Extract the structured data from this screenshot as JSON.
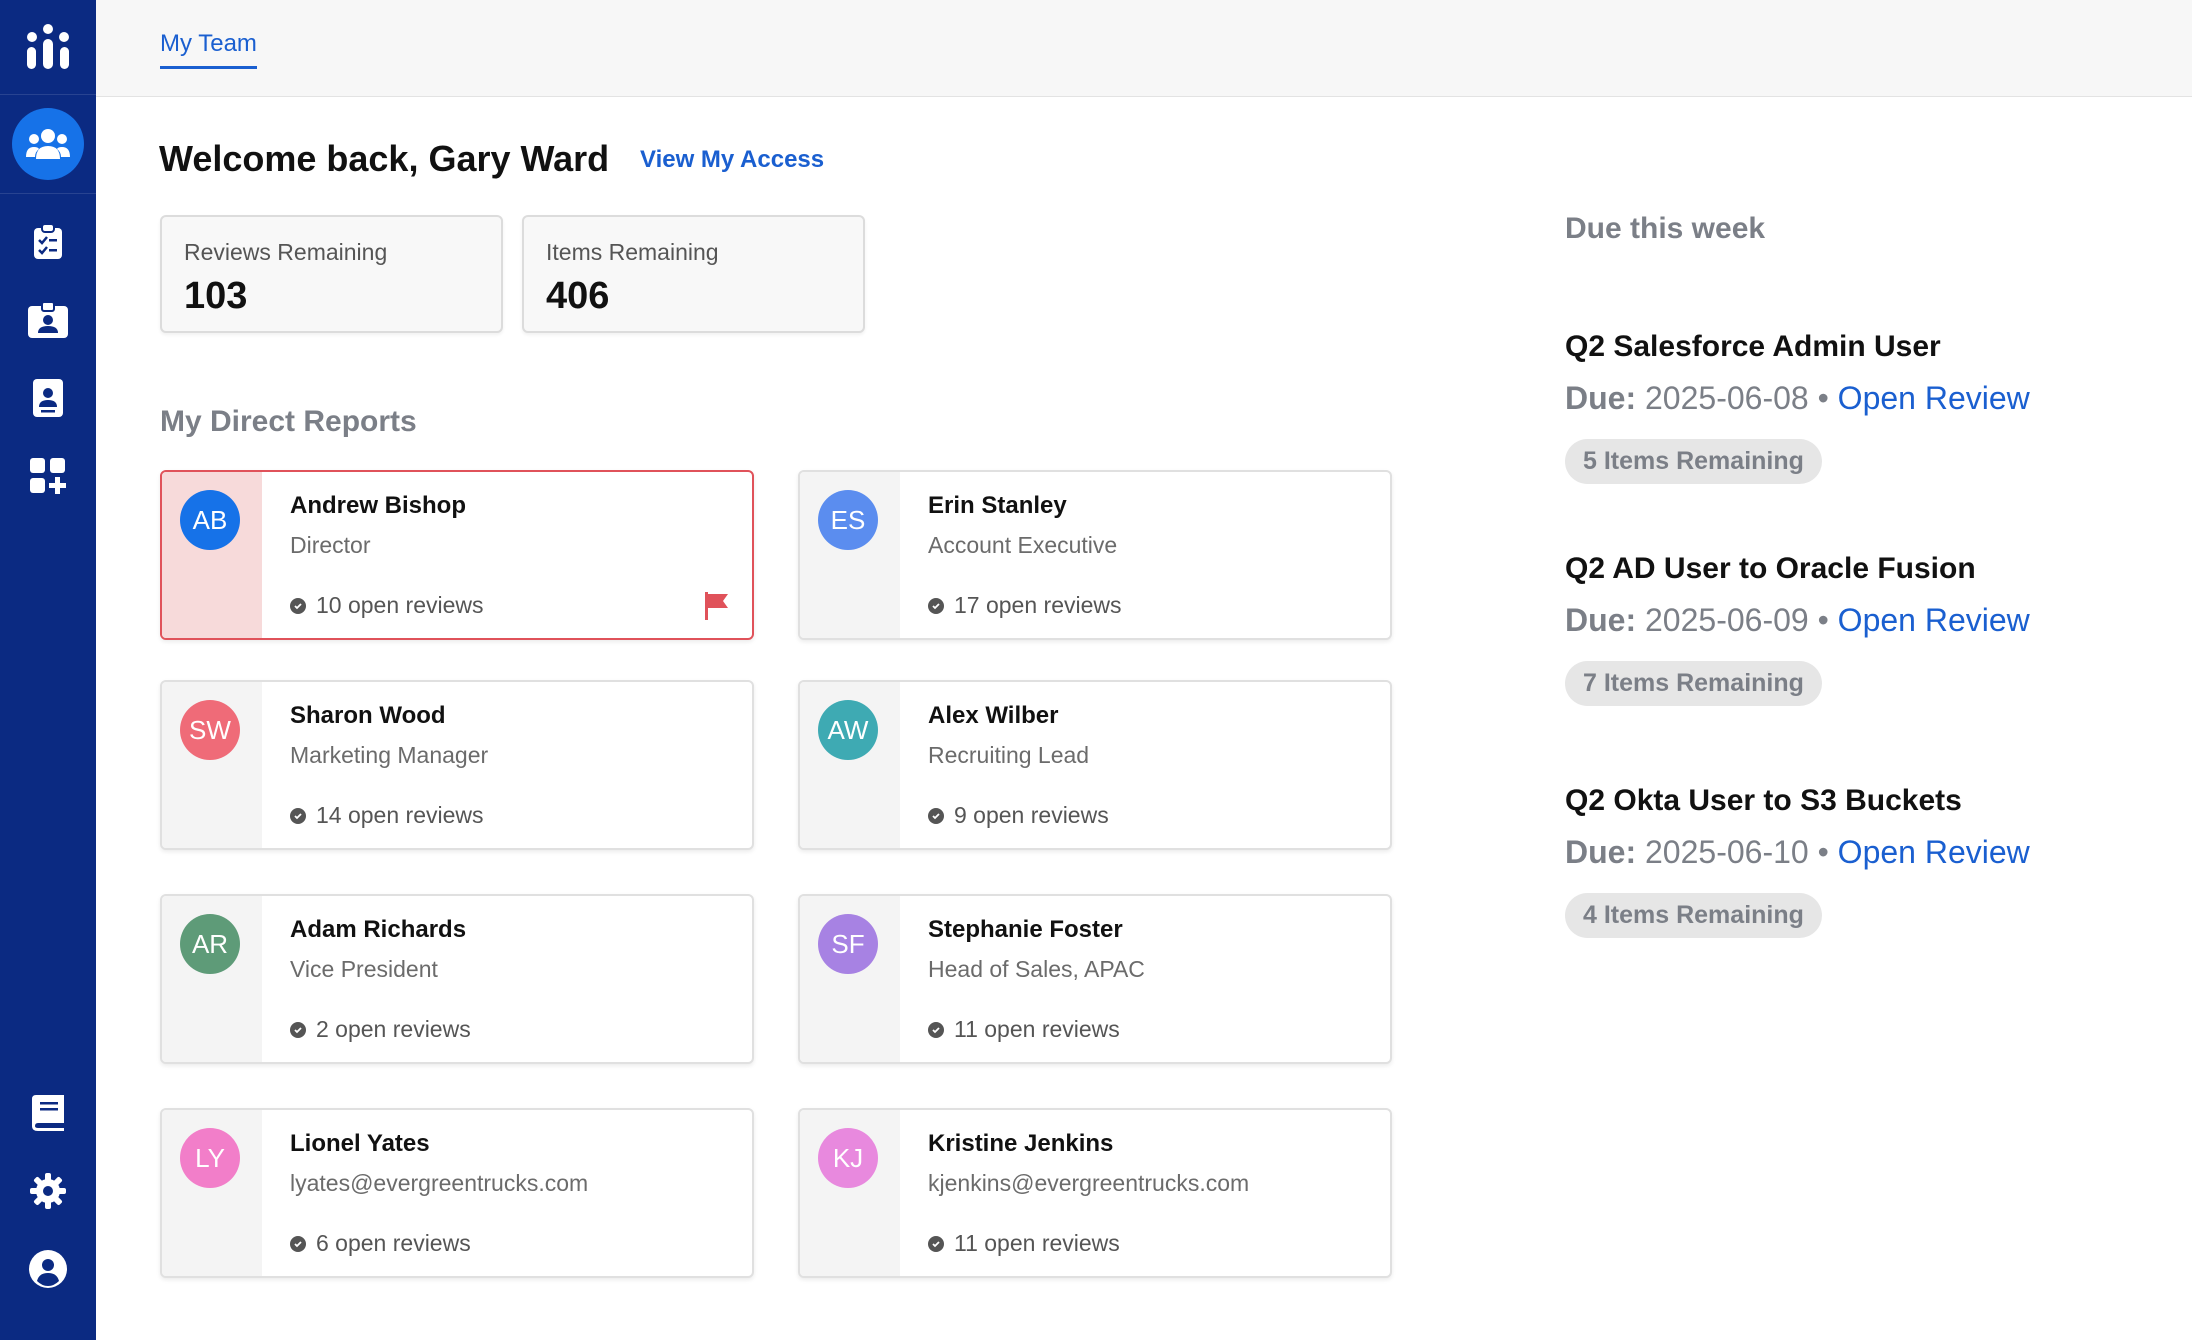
{
  "nav": {
    "tab": "My Team"
  },
  "header": {
    "welcome": "Welcome back, Gary Ward",
    "view_access": "View My Access"
  },
  "stats": [
    {
      "label": "Reviews Remaining",
      "value": "103"
    },
    {
      "label": "Items Remaining",
      "value": "406"
    }
  ],
  "direct_reports": {
    "title": "My Direct Reports",
    "items": [
      {
        "initials": "AB",
        "name": "Andrew Bishop",
        "title": "Director",
        "reviews": "10 open reviews",
        "color": "#1672e8",
        "flagged": true
      },
      {
        "initials": "ES",
        "name": "Erin Stanley",
        "title": "Account Executive",
        "reviews": "17 open reviews",
        "color": "#5b8def",
        "flagged": false
      },
      {
        "initials": "SW",
        "name": "Sharon Wood",
        "title": "Marketing Manager",
        "reviews": "14 open reviews",
        "color": "#ef6b78",
        "flagged": false
      },
      {
        "initials": "AW",
        "name": "Alex Wilber",
        "title": "Recruiting Lead",
        "reviews": "9 open reviews",
        "color": "#3eaab3",
        "flagged": false
      },
      {
        "initials": "AR",
        "name": "Adam Richards",
        "title": "Vice President",
        "reviews": "2 open reviews",
        "color": "#5e9b78",
        "flagged": false
      },
      {
        "initials": "SF",
        "name": "Stephanie Foster",
        "title": "Head of Sales, APAC",
        "reviews": "11 open reviews",
        "color": "#a782e3",
        "flagged": false
      },
      {
        "initials": "LY",
        "name": "Lionel Yates",
        "title": "lyates@evergreentrucks.com",
        "reviews": "6 open reviews",
        "color": "#f27ec9",
        "flagged": false
      },
      {
        "initials": "KJ",
        "name": "Kristine Jenkins",
        "title": "kjenkins@evergreentrucks.com",
        "reviews": "11 open reviews",
        "color": "#e889de",
        "flagged": false
      }
    ]
  },
  "due_this_week": {
    "title": "Due this week",
    "items": [
      {
        "name": "Q2 Salesforce Admin User",
        "due_label": "Due:",
        "date": "2025-06-08",
        "separator": "•",
        "link": "Open Review",
        "remaining": "5 Items Remaining"
      },
      {
        "name": "Q2 AD User to Oracle Fusion",
        "due_label": "Due:",
        "date": "2025-06-09",
        "separator": "•",
        "link": "Open Review",
        "remaining": "7 Items Remaining"
      },
      {
        "name": "Q2 Okta User to S3 Buckets",
        "due_label": "Due:",
        "date": "2025-06-10",
        "separator": "•",
        "link": "Open Review",
        "remaining": "4 Items Remaining"
      }
    ]
  },
  "icons": [
    "logo-icon",
    "team-icon",
    "clipboard-check-icon",
    "id-badge-icon",
    "contact-card-icon",
    "apps-add-icon",
    "book-icon",
    "gear-icon",
    "user-circle-icon",
    "check-circle-icon",
    "flag-icon"
  ],
  "colors": {
    "sidebar": "#0b2a82",
    "accent": "#1a5fd0",
    "active_nav": "#1672e8",
    "flag": "#e0525a"
  }
}
